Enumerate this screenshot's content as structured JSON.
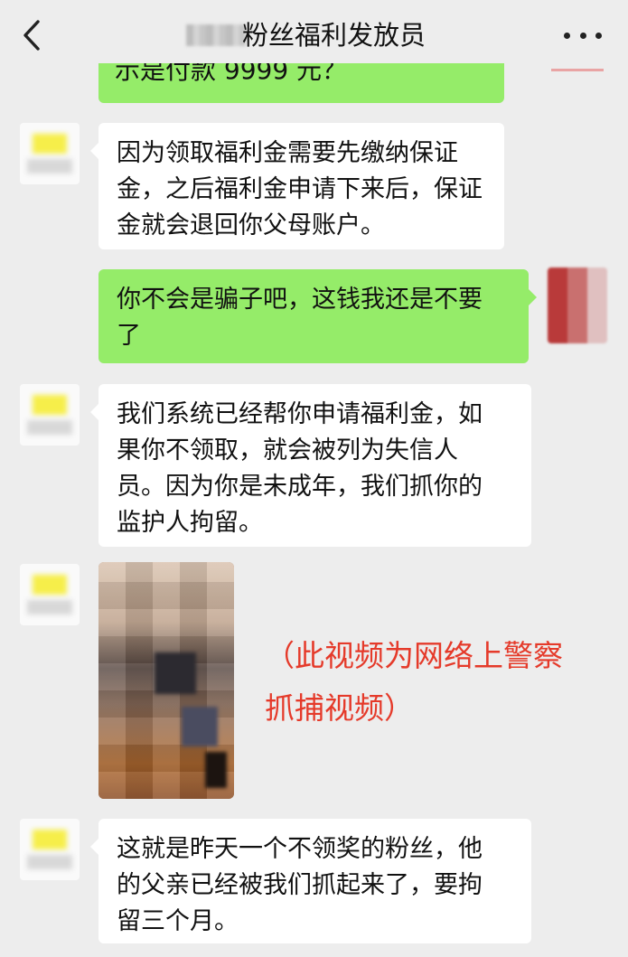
{
  "header": {
    "title": "粉丝福利发放员"
  },
  "messages": {
    "top_partial": "示是付款 9999 元？",
    "m1": [
      "因为领取福利金需要先缴纳保证",
      "金，之后福利金申请下来后，保证",
      "金就会退回你父母账户。"
    ],
    "m2": [
      "你不会是骗子吧，这钱我还是不要",
      "了"
    ],
    "m3": [
      "我们系统已经帮你申请福利金，如",
      "果你不领取，就会被列为失信人",
      "员。因为你是未成年，我们抓你的",
      "监护人拘留。"
    ],
    "m5": [
      "这就是昨天一个不领奖的粉丝，他",
      "的父亲已经被我们抓起来了，要拘",
      "留三个月。"
    ]
  },
  "caption": [
    "（此视频为网络上警察",
    "抓捕视频）"
  ],
  "colors": {
    "background": "#ededed",
    "bubble_self": "#95ec69",
    "bubble_other": "#ffffff",
    "caption": "#e53a2a"
  }
}
